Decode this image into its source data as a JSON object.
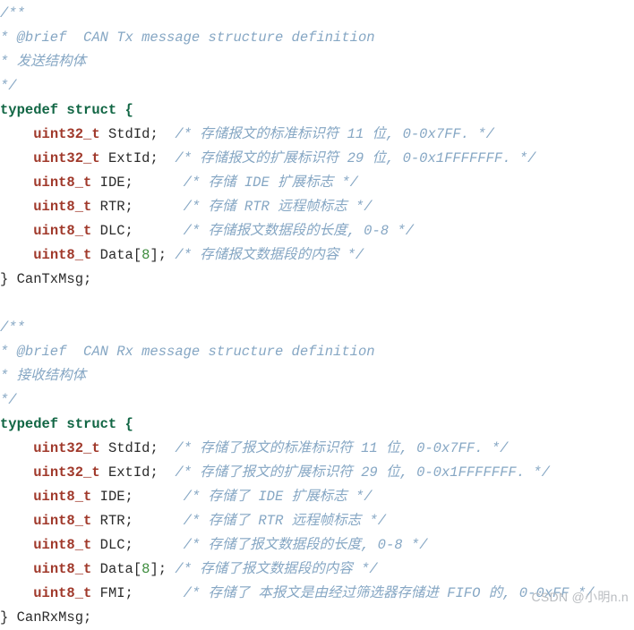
{
  "editor": {
    "language": "C",
    "background_color": "#ffffff",
    "colors": {
      "comment": "#86a7c4",
      "keyword": "#116644",
      "type": "#a0392b",
      "plain": "#2b2b2b",
      "number": "#3a8a3a",
      "watermark": "#b9bcc0"
    }
  },
  "watermark": {
    "text": "CSDN @小明n.n"
  },
  "code": {
    "lines": [
      {
        "id": "line-1",
        "tokens": [
          {
            "kind": "comment",
            "text": "/**"
          }
        ]
      },
      {
        "id": "line-2",
        "tokens": [
          {
            "kind": "comment",
            "text": "* @brief  CAN Tx message structure definition"
          }
        ]
      },
      {
        "id": "line-3",
        "tokens": [
          {
            "kind": "comment",
            "text": "* 发送结构体"
          }
        ]
      },
      {
        "id": "line-4",
        "tokens": [
          {
            "kind": "comment",
            "text": "*/"
          }
        ]
      },
      {
        "id": "line-5",
        "tokens": [
          {
            "kind": "keyword",
            "text": "typedef struct {"
          }
        ]
      },
      {
        "id": "line-6",
        "tokens": [
          {
            "kind": "plain",
            "text": "    "
          },
          {
            "kind": "type",
            "text": "uint32_t"
          },
          {
            "kind": "plain",
            "text": " StdId;  "
          },
          {
            "kind": "comment",
            "text": "/* 存储报文的标准标识符 11 位, 0-0x7FF. */"
          }
        ]
      },
      {
        "id": "line-7",
        "tokens": [
          {
            "kind": "plain",
            "text": "    "
          },
          {
            "kind": "type",
            "text": "uint32_t"
          },
          {
            "kind": "plain",
            "text": " ExtId;  "
          },
          {
            "kind": "comment",
            "text": "/* 存储报文的扩展标识符 29 位, 0-0x1FFFFFFF. */"
          }
        ]
      },
      {
        "id": "line-8",
        "tokens": [
          {
            "kind": "plain",
            "text": "    "
          },
          {
            "kind": "type",
            "text": "uint8_t"
          },
          {
            "kind": "plain",
            "text": " IDE;      "
          },
          {
            "kind": "comment",
            "text": "/* 存储 IDE 扩展标志 */"
          }
        ]
      },
      {
        "id": "line-9",
        "tokens": [
          {
            "kind": "plain",
            "text": "    "
          },
          {
            "kind": "type",
            "text": "uint8_t"
          },
          {
            "kind": "plain",
            "text": " RTR;      "
          },
          {
            "kind": "comment",
            "text": "/* 存储 RTR 远程帧标志 */"
          }
        ]
      },
      {
        "id": "line-10",
        "tokens": [
          {
            "kind": "plain",
            "text": "    "
          },
          {
            "kind": "type",
            "text": "uint8_t"
          },
          {
            "kind": "plain",
            "text": " DLC;      "
          },
          {
            "kind": "comment",
            "text": "/* 存储报文数据段的长度, 0-8 */"
          }
        ]
      },
      {
        "id": "line-11",
        "tokens": [
          {
            "kind": "plain",
            "text": "    "
          },
          {
            "kind": "type",
            "text": "uint8_t"
          },
          {
            "kind": "plain",
            "text": " Data["
          },
          {
            "kind": "number",
            "text": "8"
          },
          {
            "kind": "plain",
            "text": "]; "
          },
          {
            "kind": "comment",
            "text": "/* 存储报文数据段的内容 */"
          }
        ]
      },
      {
        "id": "line-12",
        "tokens": [
          {
            "kind": "plain",
            "text": "} CanTxMsg;"
          }
        ]
      },
      {
        "id": "line-13",
        "tokens": []
      },
      {
        "id": "line-14",
        "tokens": [
          {
            "kind": "comment",
            "text": "/**"
          }
        ]
      },
      {
        "id": "line-15",
        "tokens": [
          {
            "kind": "comment",
            "text": "* @brief  CAN Rx message structure definition"
          }
        ]
      },
      {
        "id": "line-16",
        "tokens": [
          {
            "kind": "comment",
            "text": "* 接收结构体"
          }
        ]
      },
      {
        "id": "line-17",
        "tokens": [
          {
            "kind": "comment",
            "text": "*/"
          }
        ]
      },
      {
        "id": "line-18",
        "tokens": [
          {
            "kind": "keyword",
            "text": "typedef struct {"
          }
        ]
      },
      {
        "id": "line-19",
        "tokens": [
          {
            "kind": "plain",
            "text": "    "
          },
          {
            "kind": "type",
            "text": "uint32_t"
          },
          {
            "kind": "plain",
            "text": " StdId;  "
          },
          {
            "kind": "comment",
            "text": "/* 存储了报文的标准标识符 11 位, 0-0x7FF. */"
          }
        ]
      },
      {
        "id": "line-20",
        "tokens": [
          {
            "kind": "plain",
            "text": "    "
          },
          {
            "kind": "type",
            "text": "uint32_t"
          },
          {
            "kind": "plain",
            "text": " ExtId;  "
          },
          {
            "kind": "comment",
            "text": "/* 存储了报文的扩展标识符 29 位, 0-0x1FFFFFFF. */"
          }
        ]
      },
      {
        "id": "line-21",
        "tokens": [
          {
            "kind": "plain",
            "text": "    "
          },
          {
            "kind": "type",
            "text": "uint8_t"
          },
          {
            "kind": "plain",
            "text": " IDE;      "
          },
          {
            "kind": "comment",
            "text": "/* 存储了 IDE 扩展标志 */"
          }
        ]
      },
      {
        "id": "line-22",
        "tokens": [
          {
            "kind": "plain",
            "text": "    "
          },
          {
            "kind": "type",
            "text": "uint8_t"
          },
          {
            "kind": "plain",
            "text": " RTR;      "
          },
          {
            "kind": "comment",
            "text": "/* 存储了 RTR 远程帧标志 */"
          }
        ]
      },
      {
        "id": "line-23",
        "tokens": [
          {
            "kind": "plain",
            "text": "    "
          },
          {
            "kind": "type",
            "text": "uint8_t"
          },
          {
            "kind": "plain",
            "text": " DLC;      "
          },
          {
            "kind": "comment",
            "text": "/* 存储了报文数据段的长度, 0-8 */"
          }
        ]
      },
      {
        "id": "line-24",
        "tokens": [
          {
            "kind": "plain",
            "text": "    "
          },
          {
            "kind": "type",
            "text": "uint8_t"
          },
          {
            "kind": "plain",
            "text": " Data["
          },
          {
            "kind": "number",
            "text": "8"
          },
          {
            "kind": "plain",
            "text": "]; "
          },
          {
            "kind": "comment",
            "text": "/* 存储了报文数据段的内容 */"
          }
        ]
      },
      {
        "id": "line-25",
        "tokens": [
          {
            "kind": "plain",
            "text": "    "
          },
          {
            "kind": "type",
            "text": "uint8_t"
          },
          {
            "kind": "plain",
            "text": " FMI;      "
          },
          {
            "kind": "comment",
            "text": "/* 存储了 本报文是由经过筛选器存储进 FIFO 的, 0-0xFF */"
          }
        ]
      },
      {
        "id": "line-26",
        "tokens": [
          {
            "kind": "plain",
            "text": "} CanRxMsg;"
          }
        ]
      }
    ]
  }
}
